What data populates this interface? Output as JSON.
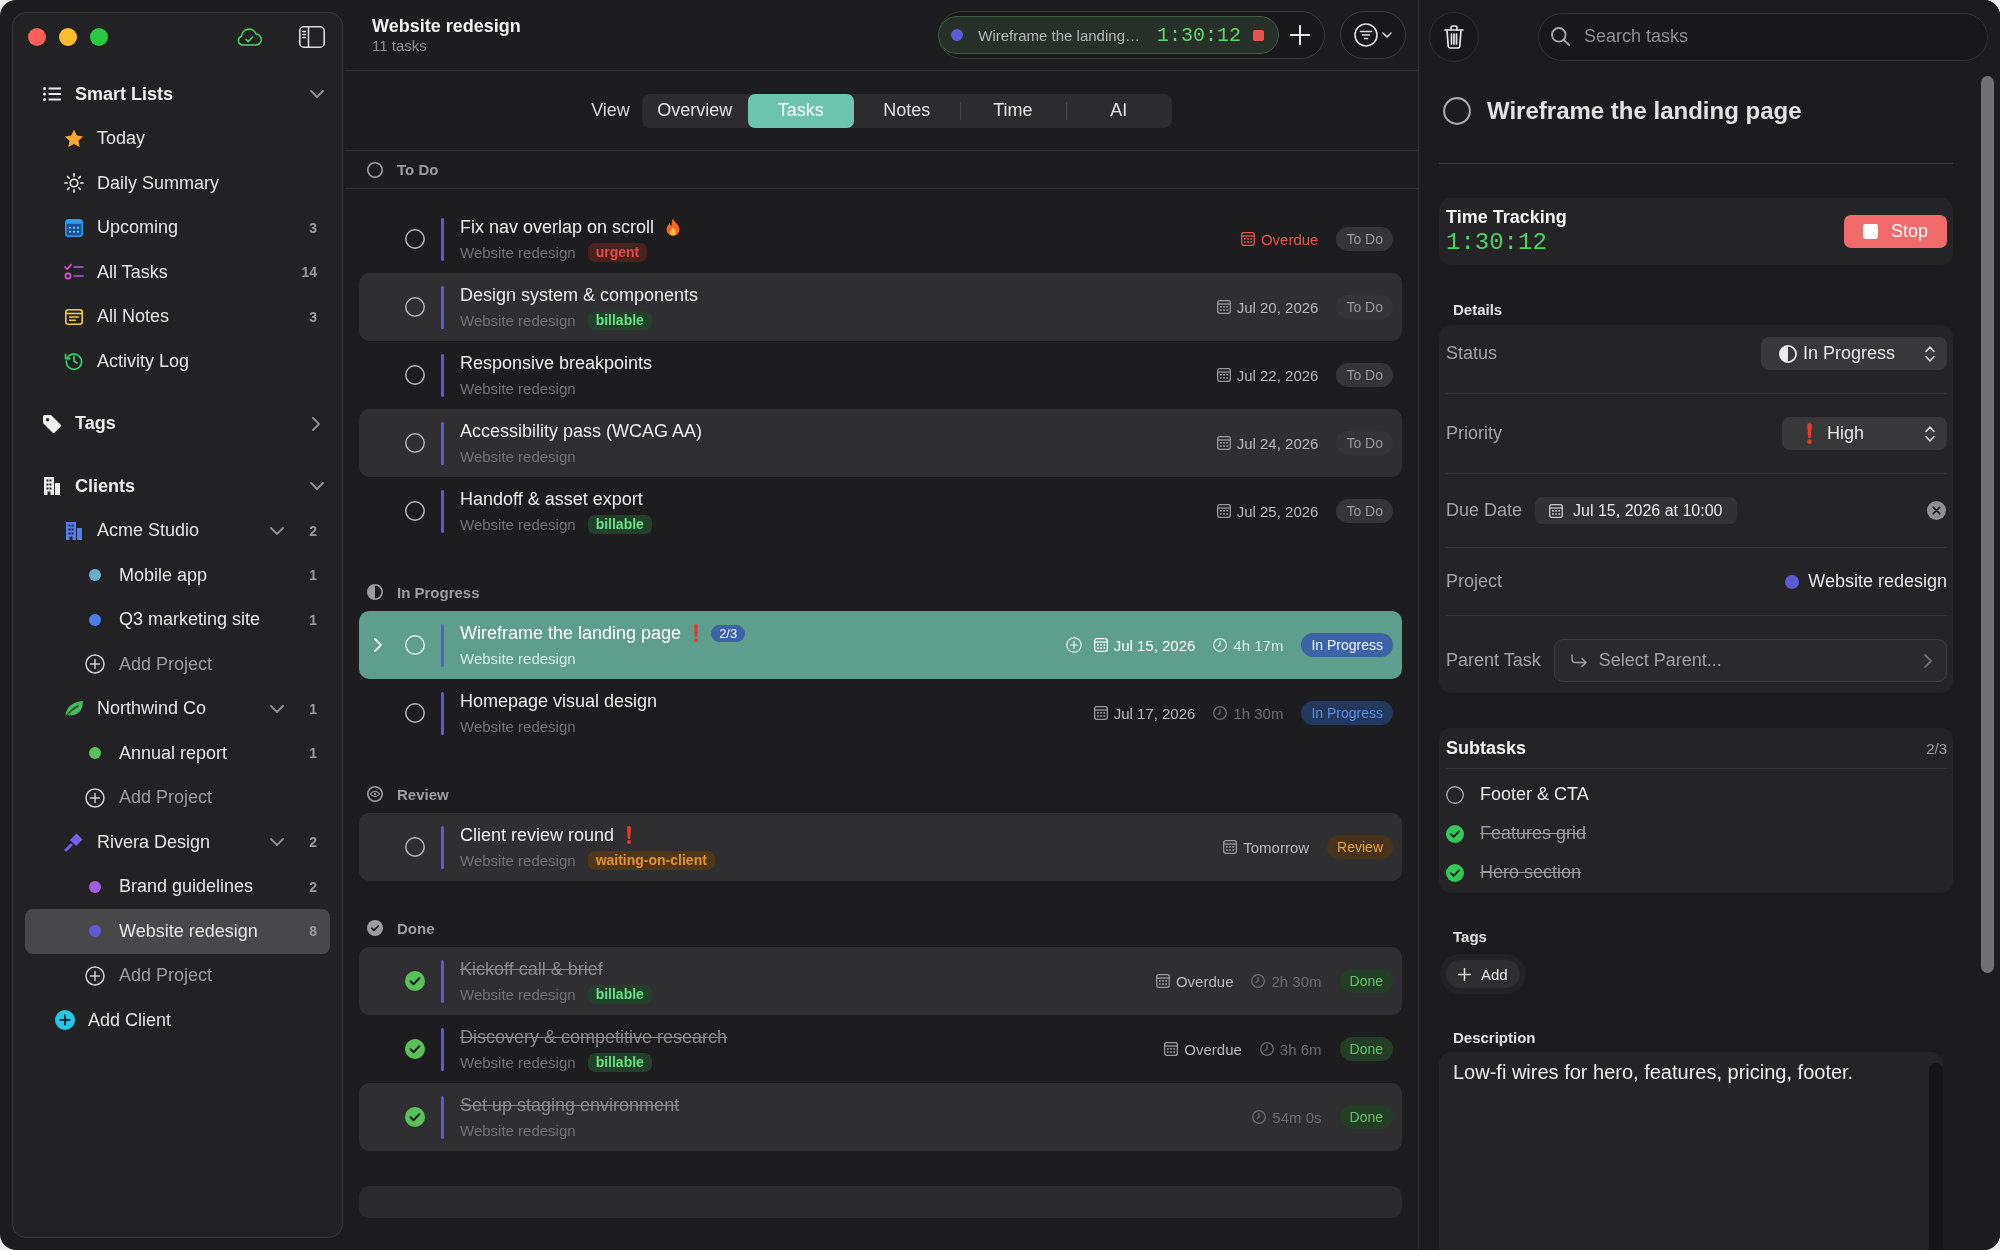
{
  "sidebar": {
    "smart_lists": {
      "title": "Smart Lists",
      "expanded": true,
      "items": [
        {
          "label": "Today",
          "selected": false
        },
        {
          "label": "Daily Summary",
          "selected": false
        },
        {
          "label": "Upcoming",
          "count": "3",
          "selected": false
        },
        {
          "label": "All Tasks",
          "count": "14",
          "selected": false
        },
        {
          "label": "All Notes",
          "count": "3",
          "selected": false
        },
        {
          "label": "Activity Log",
          "selected": false
        }
      ]
    },
    "tags": {
      "title": "Tags",
      "expanded": false
    },
    "clients": {
      "title": "Clients",
      "expanded": true,
      "items": [
        {
          "name": "Acme Studio",
          "count": "2",
          "expanded": true,
          "add_project": "Add Project",
          "children": [
            {
              "name": "Mobile app",
              "count": "1",
              "color": "#6aafc8",
              "selected": false
            },
            {
              "name": "Q3 marketing site",
              "count": "1",
              "color": "#4b7bef",
              "selected": false
            }
          ]
        },
        {
          "name": "Northwind Co",
          "count": "1",
          "expanded": true,
          "add_project": "Add Project",
          "children": [
            {
              "name": "Annual report",
              "count": "1",
              "color": "#5cbf5c",
              "selected": false
            }
          ]
        },
        {
          "name": "Rivera Design",
          "count": "2",
          "expanded": true,
          "add_project": "Add Project",
          "children": [
            {
              "name": "Brand guidelines",
              "count": "2",
              "color": "#a15fdf",
              "selected": false
            },
            {
              "name": "Website redesign",
              "count": "8",
              "color": "#5b5bd6",
              "selected": true
            }
          ]
        }
      ]
    },
    "add_client": "Add Client"
  },
  "header": {
    "title": "Website redesign",
    "subtitle": "11 tasks"
  },
  "timer": {
    "task": "Wireframe the landing…",
    "elapsed": "1:30:12"
  },
  "view": {
    "label": "View",
    "tabs": [
      {
        "label": "Overview",
        "selected": false
      },
      {
        "label": "Tasks",
        "selected": true
      },
      {
        "label": "Notes",
        "selected": false
      },
      {
        "label": "Time",
        "selected": false
      },
      {
        "label": "AI",
        "selected": false
      }
    ]
  },
  "groups": [
    {
      "title": "To Do",
      "kind": "todo",
      "tasks": [
        {
          "title": "Fix nav overlap on scroll",
          "kind": "urgent",
          "project": "Website redesign",
          "tags": [
            {
              "label": "urgent",
              "color": "#4b211e"
            }
          ],
          "due": "Overdue",
          "overdue": true,
          "status": "To Do",
          "completed": false,
          "selected": false,
          "striped": false
        },
        {
          "title": "Design system & components",
          "kind": "normal",
          "project": "Website redesign",
          "tags": [
            {
              "label": "billable",
              "color": "#23402a"
            }
          ],
          "due": "Jul 20, 2026",
          "overdue": false,
          "status": "To Do",
          "completed": false,
          "selected": false,
          "striped": true
        },
        {
          "title": "Responsive breakpoints",
          "kind": "normal",
          "project": "Website redesign",
          "due": "Jul 22, 2026",
          "overdue": false,
          "status": "To Do",
          "completed": false,
          "selected": false,
          "striped": false
        },
        {
          "title": "Accessibility pass (WCAG AA)",
          "kind": "normal",
          "project": "Website redesign",
          "due": "Jul 24, 2026",
          "overdue": false,
          "status": "To Do",
          "completed": false,
          "selected": false,
          "striped": true
        },
        {
          "title": "Handoff & asset export",
          "kind": "normal",
          "project": "Website redesign",
          "tags": [
            {
              "label": "billable",
              "color": "#23402a"
            }
          ],
          "due": "Jul 25, 2026",
          "overdue": false,
          "status": "To Do",
          "completed": false,
          "selected": false,
          "striped": false
        }
      ]
    },
    {
      "title": "In Progress",
      "kind": "in_progress",
      "tasks": [
        {
          "title": "Wireframe the landing page",
          "kind": "high",
          "subtasks": "2/3",
          "project": "Website redesign",
          "due": "Jul 15, 2026",
          "overdue": false,
          "time": "4h 17m",
          "status": "In Progress",
          "completed": false,
          "selected": true
        },
        {
          "title": "Homepage visual design",
          "kind": "normal",
          "project": "Website redesign",
          "due": "Jul 17, 2026",
          "overdue": false,
          "time": "1h 30m",
          "status": "In Progress",
          "completed": false,
          "selected": false,
          "striped": false
        }
      ]
    },
    {
      "title": "Review",
      "kind": "review",
      "tasks": [
        {
          "title": "Client review round",
          "kind": "high",
          "project": "Website redesign",
          "tags": [
            {
              "label": "waiting-on-client",
              "color": "#4f3819"
            }
          ],
          "due": "Tomorrow",
          "overdue": false,
          "status": "Review",
          "completed": false,
          "selected": false,
          "striped": true
        }
      ]
    },
    {
      "title": "Done",
      "kind": "done",
      "tasks": [
        {
          "title": "Kickoff call & brief",
          "kind": "normal",
          "project": "Website redesign",
          "tags": [
            {
              "label": "billable",
              "color": "#23402a"
            }
          ],
          "due": "Overdue",
          "overdue": false,
          "time": "2h 30m",
          "status": "Done",
          "completed": true,
          "selected": false,
          "striped": true
        },
        {
          "title": "Discovery & competitive research",
          "kind": "normal",
          "project": "Website redesign",
          "tags": [
            {
              "label": "billable",
              "color": "#23402a"
            }
          ],
          "due": "Overdue",
          "overdue": false,
          "time": "3h 6m",
          "status": "Done",
          "completed": true,
          "selected": false,
          "striped": false
        },
        {
          "title": "Set up staging environment",
          "kind": "normal",
          "project": "Website redesign",
          "time": "54m 0s",
          "status": "Done",
          "completed": true,
          "selected": false,
          "striped": true
        }
      ]
    }
  ],
  "search": {
    "placeholder": "Search tasks"
  },
  "detail": {
    "title": "Wireframe the landing page",
    "completed": false,
    "time_tracking": {
      "title": "Time Tracking",
      "elapsed": "1:30:12",
      "button": "Stop"
    },
    "details": {
      "title": "Details",
      "rows": [
        {
          "kind": "status",
          "label": "Status",
          "value": "In Progress"
        },
        {
          "kind": "priority",
          "label": "Priority",
          "value": "High"
        },
        {
          "kind": "date",
          "label": "Due Date",
          "value": "Jul 15, 2026 at 10:00"
        },
        {
          "kind": "project",
          "label": "Project",
          "value": "Website redesign"
        },
        {
          "kind": "parent",
          "label": "Parent Task",
          "value": "Select Parent..."
        }
      ]
    },
    "subtasks": {
      "title": "Subtasks",
      "count": "2/3",
      "items": [
        {
          "title": "Footer & CTA",
          "completed": false
        },
        {
          "title": "Features grid",
          "completed": true
        },
        {
          "title": "Hero section",
          "completed": true
        }
      ]
    },
    "tags": {
      "title": "Tags",
      "add": "Add"
    },
    "description": {
      "title": "Description",
      "value": "Low-fi wires for hero, features, pricing, footer."
    }
  }
}
